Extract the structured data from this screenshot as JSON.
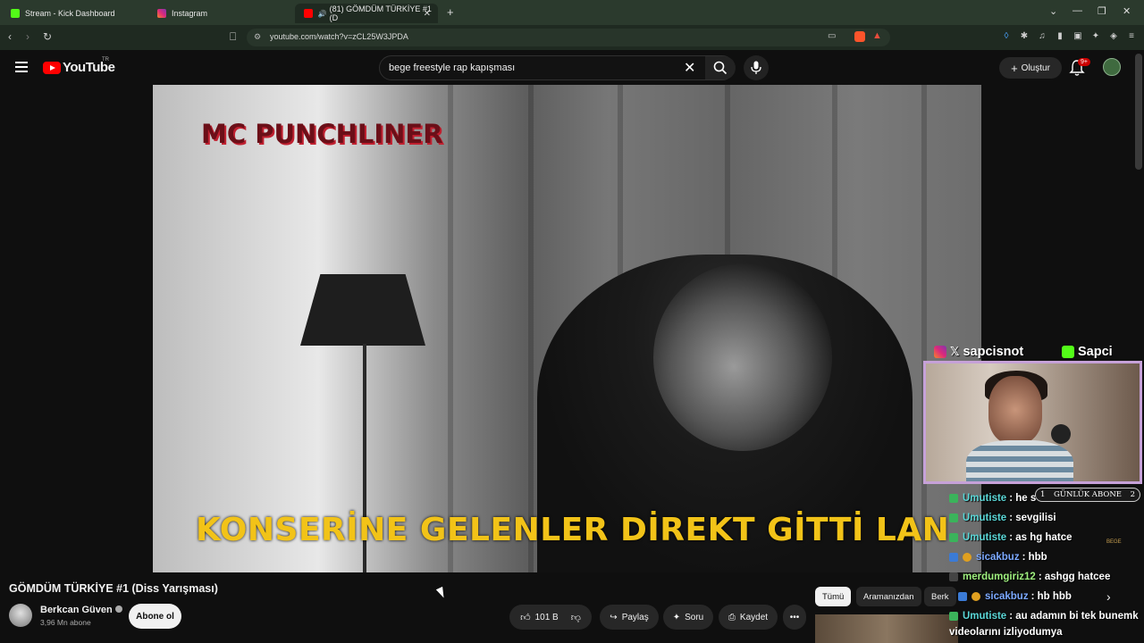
{
  "browser": {
    "tabs": [
      {
        "title": "Stream - Kick Dashboard",
        "favicon_color": "#53fc18"
      },
      {
        "title": "Instagram",
        "favicon_color": "#e1306c"
      },
      {
        "title": "(81) GÖMDÜM TÜRKİYE #1 (D",
        "favicon_color": "#ff0000",
        "active": true
      }
    ],
    "url": "youtube.com/watch?v=zCL25W3JPDA"
  },
  "youtube": {
    "logo_text": "YouTube",
    "region": "TR",
    "search_query": "bege freestyle rap kapışması",
    "create_label": "Oluştur",
    "notification_count": "9+"
  },
  "video": {
    "overlay_top": "MC PUNCHLINER",
    "subtitle": "KONSERİNE GELENLER DİREKT GİTTİ LAN",
    "title": "GÖMDÜM TÜRKİYE #1 (Diss Yarışması)",
    "channel": "Berkcan Güven",
    "subscribers": "3,96 Mn abone",
    "subscribe_label": "Abone ol",
    "likes": "101 B",
    "share_label": "Paylaş",
    "ask_label": "Soru",
    "save_label": "Kaydet"
  },
  "chips": [
    "Tümü",
    "Aramanızdan",
    "Berk"
  ],
  "stream_overlay": {
    "streamer_name": "sapcisnot",
    "kick_name": "Sapci",
    "sub_goal_left": "1",
    "sub_goal_label": "GÜNLÜK ABONE",
    "sub_goal_right": "2",
    "watermark": "BEGE"
  },
  "chat": [
    {
      "user": "Umutiste",
      "msg": ": he s"
    },
    {
      "user": "Umutiste",
      "msg": ": sevgilisi"
    },
    {
      "user": "Umutiste",
      "msg": ": as hg hatce"
    },
    {
      "user": "sicakbuz",
      "msg": ": hbb"
    },
    {
      "user": "merdumgiriz12",
      "msg": ": ashgg hatcee"
    },
    {
      "user": "sicakbuz",
      "msg": ": hb hbb"
    },
    {
      "user": "Umutiste",
      "msg": ": au adamın bi tek bunemk"
    },
    {
      "user": "",
      "msg": "videolarını izliyodumya"
    }
  ]
}
